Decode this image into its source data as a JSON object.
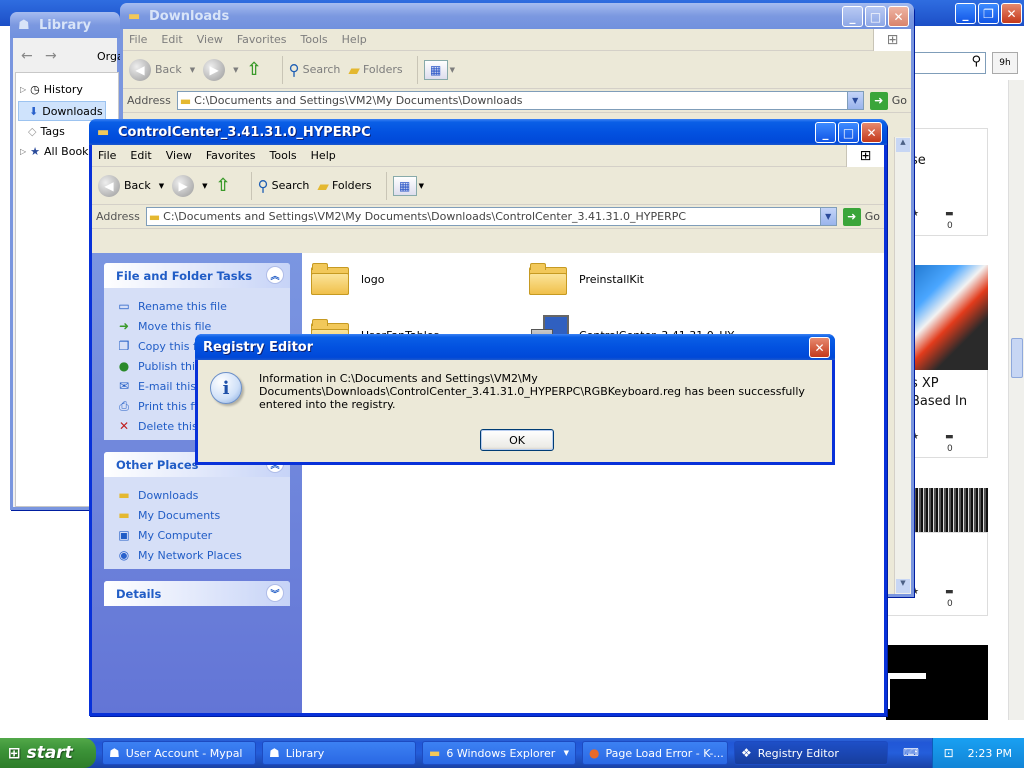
{
  "background_browser": {
    "search_placeholder": "",
    "button_9h": "9h",
    "cards": [
      {
        "text": "se",
        "stars": "0",
        "comments": "0"
      },
      {
        "text": "s XP",
        "text2": "Based In",
        "stars": "0",
        "comments": "0"
      },
      {
        "stars": "0",
        "comments": "0"
      }
    ]
  },
  "library": {
    "title": "Library",
    "organize": "Orga",
    "items": [
      "History",
      "Downloads",
      "Tags",
      "All Bookm"
    ]
  },
  "downloads_window": {
    "title": "Downloads",
    "menu": [
      "File",
      "Edit",
      "View",
      "Favorites",
      "Tools",
      "Help"
    ],
    "back": "Back",
    "search": "Search",
    "folders": "Folders",
    "address_label": "Address",
    "address": "C:\\Documents and Settings\\VM2\\My Documents\\Downloads",
    "go": "Go"
  },
  "cc_window": {
    "title": "ControlCenter_3.41.31.0_HYPERPC",
    "menu": [
      "File",
      "Edit",
      "View",
      "Favorites",
      "Tools",
      "Help"
    ],
    "back": "Back",
    "search": "Search",
    "folders": "Folders",
    "address_label": "Address",
    "address": "C:\\Documents and Settings\\VM2\\My Documents\\Downloads\\ControlCenter_3.41.31.0_HYPERPC",
    "go": "Go",
    "tasks": {
      "file_folder_title": "File and Folder Tasks",
      "file_folder_items": [
        "Rename this file",
        "Move this file",
        "Copy this file",
        "Publish this",
        "E-mail this f",
        "Print this fil",
        "Delete this"
      ],
      "other_places_title": "Other Places",
      "other_places_items": [
        "Downloads",
        "My Documents",
        "My Computer",
        "My Network Places"
      ],
      "details_title": "Details"
    },
    "files": [
      "logo",
      "PreinstallKit",
      "UserFanTables",
      "ControlCenter_3.41.31.0_HY..."
    ]
  },
  "dialog": {
    "title": "Registry Editor",
    "message": "Information in C:\\Documents and Settings\\VM2\\My Documents\\Downloads\\ControlCenter_3.41.31.0_HYPERPC\\RGBKeyboard.reg has been successfully entered into the registry.",
    "ok": "OK"
  },
  "taskbar": {
    "start": "start",
    "tasks": [
      "User Account - Mypal",
      "Library",
      "6 Windows Explorer",
      "Page Load Error - K-...",
      "Registry Editor"
    ],
    "clock": "2:23 PM"
  }
}
